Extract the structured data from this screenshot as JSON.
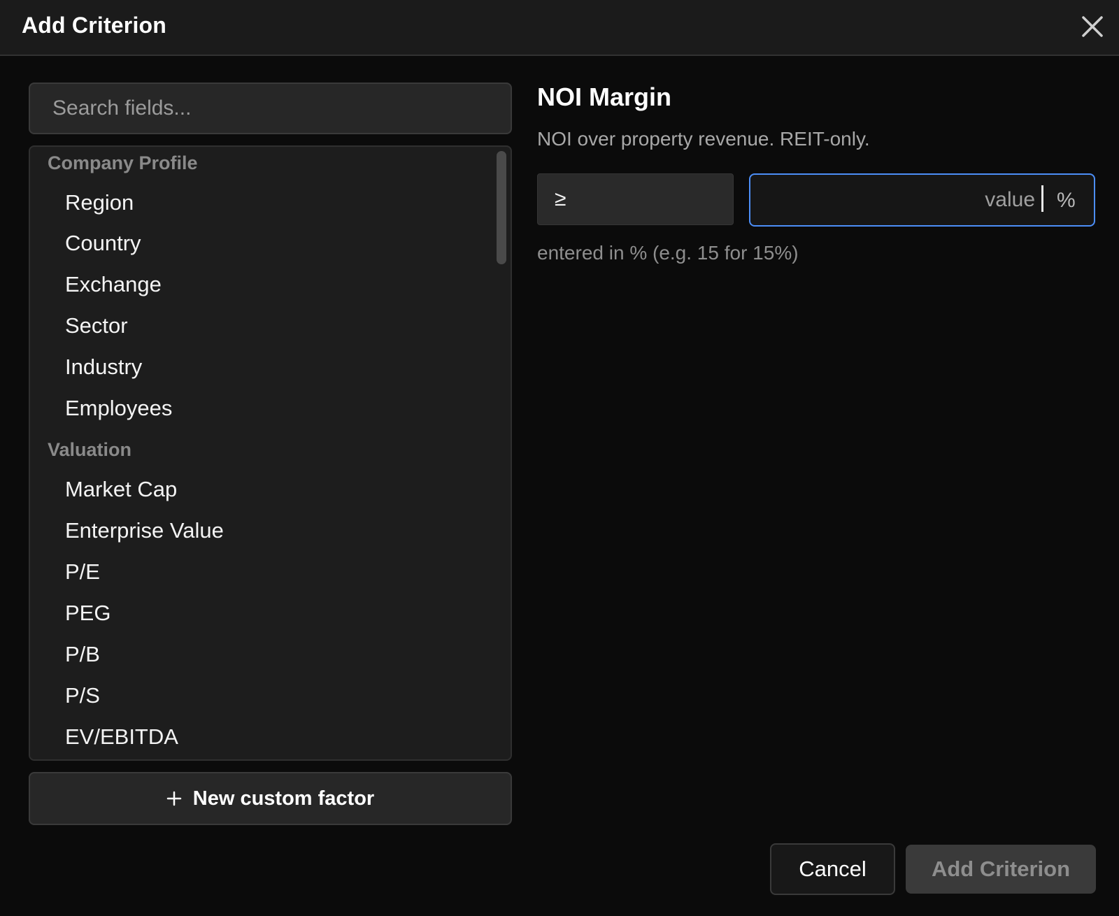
{
  "dialog": {
    "title": "Add Criterion",
    "close_icon": "close-icon"
  },
  "search": {
    "placeholder": "Search fields...",
    "value": ""
  },
  "field_groups": [
    {
      "label": "Company Profile",
      "items": [
        "Region",
        "Country",
        "Exchange",
        "Sector",
        "Industry",
        "Employees"
      ]
    },
    {
      "label": "Valuation",
      "items": [
        "Market Cap",
        "Enterprise Value",
        "P/E",
        "PEG",
        "P/B",
        "P/S",
        "EV/EBITDA"
      ]
    }
  ],
  "new_factor": {
    "icon": "plus-icon",
    "label": "New custom factor"
  },
  "detail": {
    "field_name": "NOI Margin",
    "description": "NOI over property revenue. REIT-only.",
    "operator": "≥",
    "value_placeholder": "value",
    "value": "",
    "unit": "%",
    "hint": "entered in % (e.g. 15 for 15%)"
  },
  "footer": {
    "cancel_label": "Cancel",
    "add_label": "Add Criterion"
  },
  "colors": {
    "accent": "#4c8ef7",
    "background": "#0b0b0b",
    "header": "#1b1b1b",
    "panel": "#1d1d1d"
  }
}
